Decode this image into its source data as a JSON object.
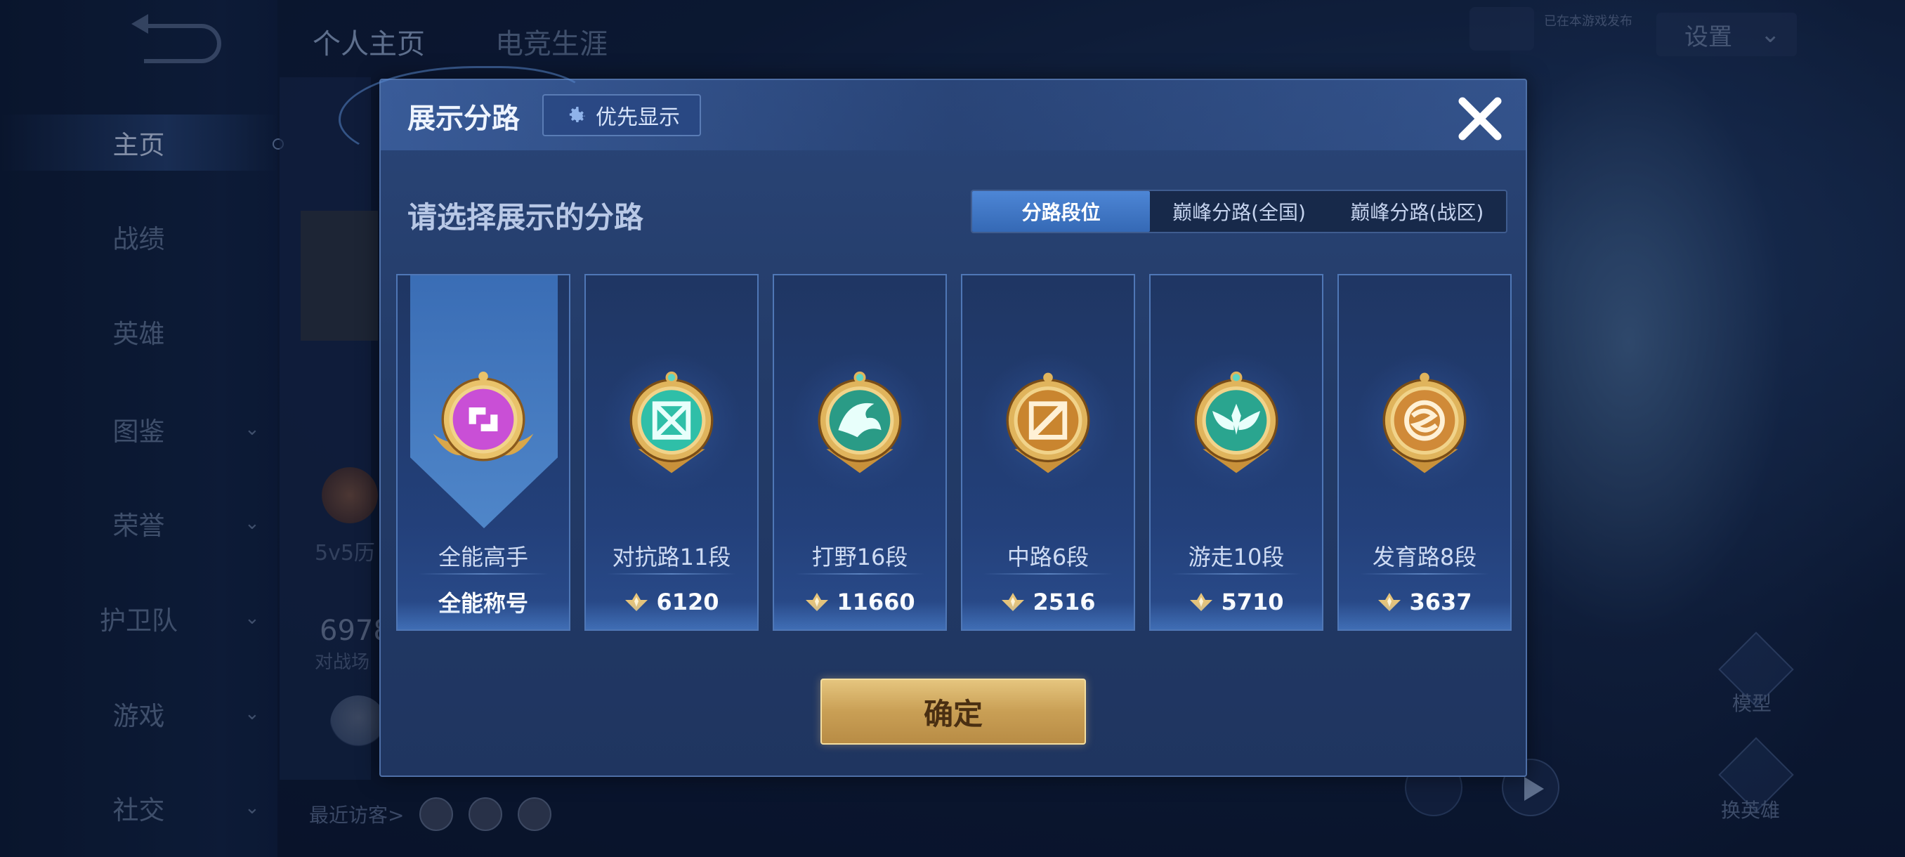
{
  "sidebar": {
    "items": [
      {
        "label": "主页",
        "active": true
      },
      {
        "label": "战绩"
      },
      {
        "label": "英雄"
      },
      {
        "label": "图鉴",
        "chevron": true
      },
      {
        "label": "荣誉",
        "chevron": true
      },
      {
        "label": "护卫队",
        "chevron": true
      },
      {
        "label": "游戏",
        "chevron": true
      },
      {
        "label": "社交",
        "chevron": true
      }
    ]
  },
  "top_tabs": [
    "个人主页",
    "电竞生涯"
  ],
  "settings_label": "设置",
  "bg_texts": {
    "mini": "已在本游戏发布",
    "mode": "5v5历",
    "count": "6978",
    "sub": "对战场",
    "visitors": "最近访客>",
    "model": "模型",
    "swap": "换英雄"
  },
  "modal": {
    "title": "展示分路",
    "priority_label": "优先显示",
    "subtitle": "请选择展示的分路",
    "tabs": [
      {
        "label": "分路段位",
        "active": true
      },
      {
        "label": "巅峰分路(全国)"
      },
      {
        "label": "巅峰分路(战区)"
      }
    ],
    "cards": [
      {
        "name": "全能高手",
        "value": "全能称号",
        "selected": true,
        "color": "#c94fd6"
      },
      {
        "name": "对抗路11段",
        "value": "6120",
        "color": "#2fbfa8"
      },
      {
        "name": "打野16段",
        "value": "11660",
        "color": "#2a9b86"
      },
      {
        "name": "中路6段",
        "value": "2516",
        "color": "#c9852f"
      },
      {
        "name": "游走10段",
        "value": "5710",
        "color": "#2aa58f"
      },
      {
        "name": "发育路8段",
        "value": "3637",
        "color": "#d08a38"
      }
    ],
    "confirm_label": "确定"
  }
}
